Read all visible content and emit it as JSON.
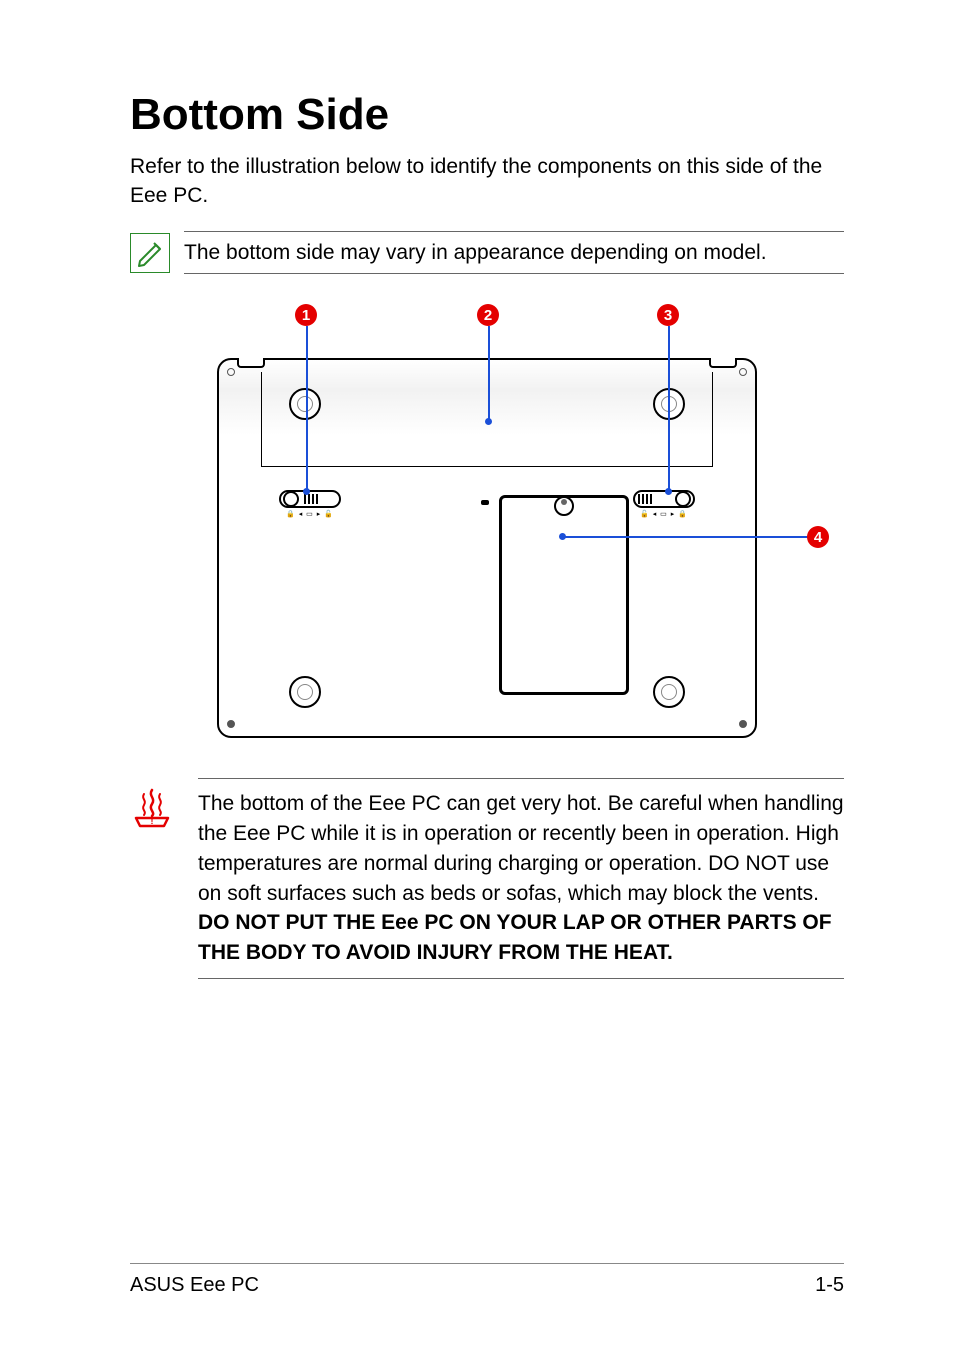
{
  "heading": "Bottom Side",
  "intro": "Refer to the illustration below to identify the components on this side of the Eee PC.",
  "note": "The bottom side may vary in appearance depending on model.",
  "callouts": {
    "c1": "1",
    "c2": "2",
    "c3": "3",
    "c4": "4"
  },
  "latch_icons_left": "🔒 ◂ ▭ ▸ 🔓",
  "latch_icons_right": "🔓 ◂ ▭ ▸ 🔒",
  "caution": {
    "part1": "The bottom of the Eee PC can get very hot. Be careful when handling the Eee PC while it is in operation or recently been in operation. High temperatures are normal during charging or operation. DO NOT use on soft surfaces such as beds or sofas, which may block the vents. ",
    "bold": "DO NOT PUT THE Eee PC ON YOUR LAP OR OTHER PARTS OF THE BODY TO AVOID INJURY FROM THE HEAT."
  },
  "footer": {
    "left": "ASUS Eee PC",
    "right": "1-5"
  }
}
